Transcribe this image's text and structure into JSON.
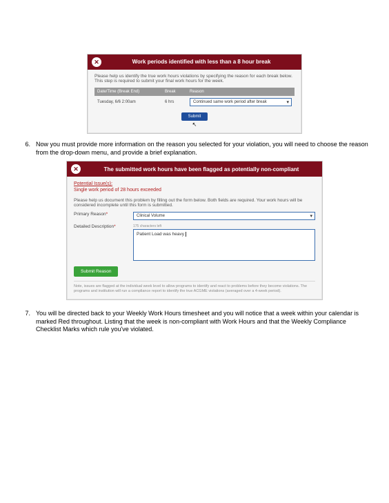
{
  "panel1": {
    "title": "Work periods identified with less than a 8 hour break",
    "helptext": "Please help us identify the true work hours violations by specifying the reason for each break below. This step is required to submit your final work hours for the week.",
    "head": {
      "date": "Date/Time (Break End)",
      "break": "Break",
      "reason": "Reason"
    },
    "row": {
      "date": "Tuesday, 6/6 2:00am",
      "break": "6 hrs",
      "reason": "Continued same work period after break"
    },
    "submit": "Submit",
    "cursor": "↖"
  },
  "step6": {
    "num": "6.",
    "text": "Now you must provide more information on the reason you selected for your violation, you will need to choose the reason from the drop-down menu, and provide a brief   explanation."
  },
  "panel2": {
    "title": "The submitted work hours have been flagged as potentially non-compliant",
    "issues_label": "Potential Issue(s):",
    "issues_text": "Single work period of 28 hours exceeded",
    "helptext": "Please help us document this problem by filling out the form below. Both fields are required. Your work hours will be considered incomplete until this form is submitted.",
    "primary_label": "Primary Reason",
    "primary_value": "Clinical Volume",
    "desc_label": "Detailed Description",
    "charcount": "175 characters left",
    "desc_value": "Patient Load was heavy",
    "submit": "Submit Reason",
    "note": "Note, issues are flagged at the individual week level to allow programs to identify and react to problems before they become violations. The programs and institution will run a compliance report to identify the true ACGME violations (averaged over a 4-week period)."
  },
  "step7": {
    "num": "7.",
    "text": " You will be directed back to your Weekly Work Hours timesheet and you will notice that a week within your calendar is marked Red throughout.  Listing that the week is non-compliant with Work Hours and that the Weekly Compliance Checklist Marks which rule you've violated."
  }
}
